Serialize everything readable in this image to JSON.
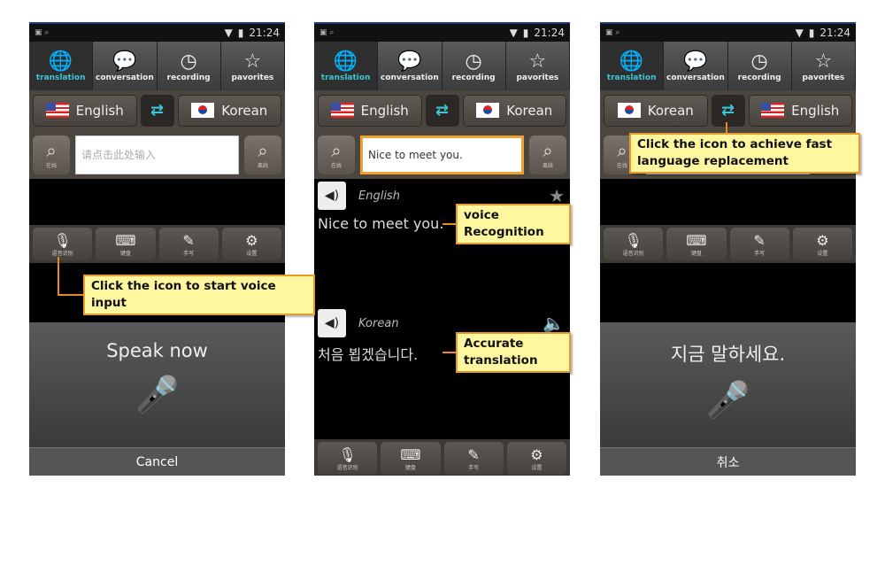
{
  "status": {
    "time": "21:24"
  },
  "tabs": [
    {
      "label": "translation",
      "icon": "globe-icon",
      "glyph": "🌐"
    },
    {
      "label": "conversation",
      "icon": "chat-bubble-icon",
      "glyph": "💬"
    },
    {
      "label": "recording",
      "icon": "clock-icon",
      "glyph": "◷"
    },
    {
      "label": "pavorites",
      "icon": "star-icon",
      "glyph": "☆"
    }
  ],
  "search": {
    "online": "在线",
    "offline": "离线",
    "glyph": "⌕"
  },
  "toolbar": [
    {
      "label": "语音识别",
      "icon": "microphone-icon",
      "glyph": "🎙"
    },
    {
      "label": "键盘",
      "icon": "keyboard-icon",
      "glyph": "⌨"
    },
    {
      "label": "手写",
      "icon": "pen-icon",
      "glyph": "✎"
    },
    {
      "label": "设置",
      "icon": "gear-icon",
      "glyph": "⚙"
    }
  ],
  "swap_glyph": "⇄",
  "accent": "#3bc6d8",
  "callout_color": "#fff6a0",
  "phones": [
    {
      "from": {
        "label": "English",
        "flag": "us"
      },
      "to": {
        "label": "Korean",
        "flag": "kr"
      },
      "input_placeholder": "请点击此处输入",
      "speak_prompt": "Speak now",
      "cancel": "Cancel",
      "callout": "Click the icon to start voice input"
    },
    {
      "from": {
        "label": "English",
        "flag": "us"
      },
      "to": {
        "label": "Korean",
        "flag": "kr"
      },
      "input_value": "Nice to meet you.",
      "results": [
        {
          "lang": "English",
          "text": "Nice to meet you.",
          "action": "★"
        },
        {
          "lang": "Korean",
          "text": "처음 뵙겠습니다.",
          "action": "🔈"
        }
      ],
      "callouts": [
        "voice Recognition",
        "Accurate translation"
      ]
    },
    {
      "from": {
        "label": "Korean",
        "flag": "kr"
      },
      "to": {
        "label": "English",
        "flag": "us"
      },
      "speak_prompt": "지금 말하세요.",
      "cancel": "취소",
      "callout": "Click the icon to achieve fast language replacement"
    }
  ]
}
